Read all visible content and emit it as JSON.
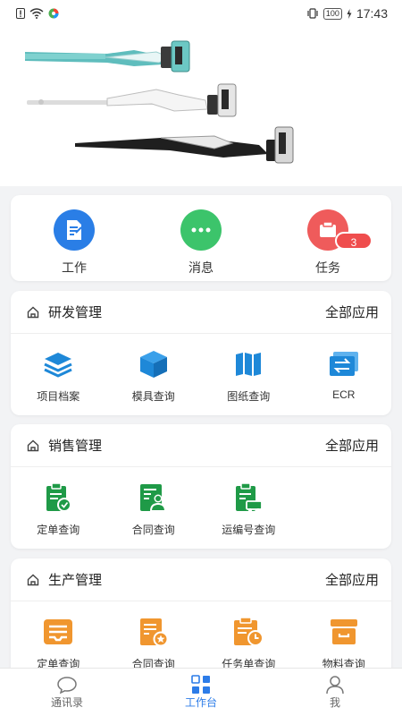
{
  "status_bar": {
    "time": "17:43",
    "battery": "100",
    "left_icons": [
      "alert-icon",
      "wifi-icon",
      "app-icon"
    ],
    "right_icons": [
      "vibrate-icon",
      "battery-icon"
    ]
  },
  "banner": {
    "image": "vacuum-cleaners-banner"
  },
  "quick_actions": [
    {
      "label": "工作",
      "icon": "document-icon",
      "color": "#2a7ee6"
    },
    {
      "label": "消息",
      "icon": "chat-bubble-icon",
      "color": "#3cc46b"
    },
    {
      "label": "任务",
      "icon": "task-icon",
      "color": "#ef5b5b",
      "badge": "3"
    }
  ],
  "sections": {
    "rd": {
      "title": "研发管理",
      "all_label": "全部应用",
      "items": [
        {
          "label": "项目档案",
          "icon": "layers-icon"
        },
        {
          "label": "模具查询",
          "icon": "cube-icon"
        },
        {
          "label": "图纸查询",
          "icon": "map-icon"
        },
        {
          "label": "ECR",
          "icon": "exchange-icon"
        }
      ],
      "color": "#1e88d8"
    },
    "sales": {
      "title": "销售管理",
      "all_label": "全部应用",
      "items": [
        {
          "label": "定单查询",
          "icon": "order-tag-icon"
        },
        {
          "label": "合同查询",
          "icon": "contract-icon"
        },
        {
          "label": "运编号查询",
          "icon": "shipping-icon"
        }
      ],
      "color": "#1f9a47"
    },
    "production": {
      "title": "生产管理",
      "all_label": "全部应用",
      "items": [
        {
          "label": "定单查询",
          "icon": "inbox-icon"
        },
        {
          "label": "合同查询",
          "icon": "doc-star-icon"
        },
        {
          "label": "任务单查询",
          "icon": "clipboard-clock-icon"
        },
        {
          "label": "物料查询",
          "icon": "box-icon"
        }
      ],
      "color": "#f0962f"
    }
  },
  "tabbar": [
    {
      "label": "通讯录",
      "icon": "chat-icon",
      "active": false
    },
    {
      "label": "工作台",
      "icon": "grid-icon",
      "active": true
    },
    {
      "label": "我",
      "icon": "person-icon",
      "active": false
    }
  ],
  "colors": {
    "accent": "#2c7ce8",
    "background": "#f2f3f5"
  }
}
